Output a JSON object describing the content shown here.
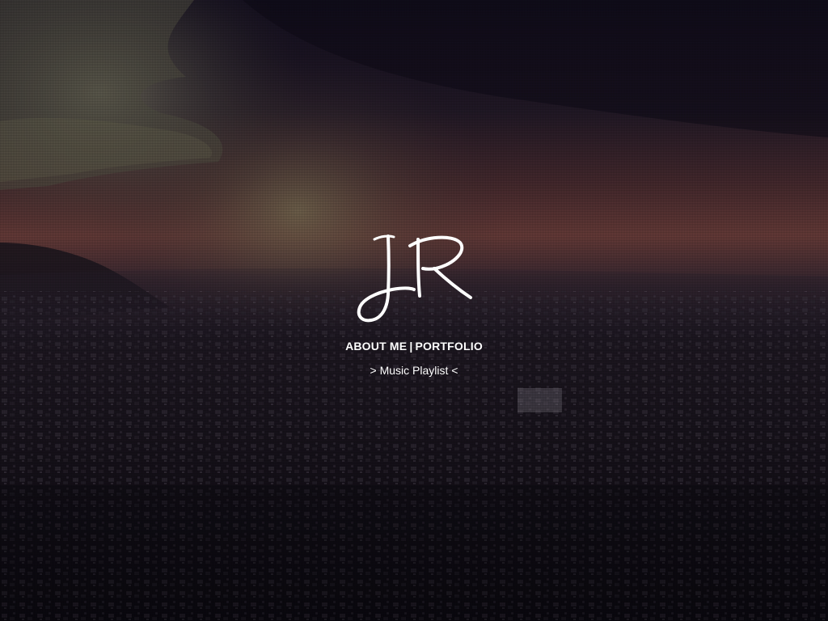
{
  "logo": {
    "text": "JR"
  },
  "nav": {
    "about_label": "ABOUT ME",
    "separator": "|",
    "portfolio_label": "PORTFOLIO"
  },
  "playlist": {
    "label": "> Music Playlist <"
  },
  "colors": {
    "text": "#ffffff",
    "sky_dark": "#0e0b1a",
    "horizon_glow": "#6b3a38",
    "city": "#1a1520"
  },
  "background": {
    "description_icon": "aerial-city-sunset-image"
  }
}
